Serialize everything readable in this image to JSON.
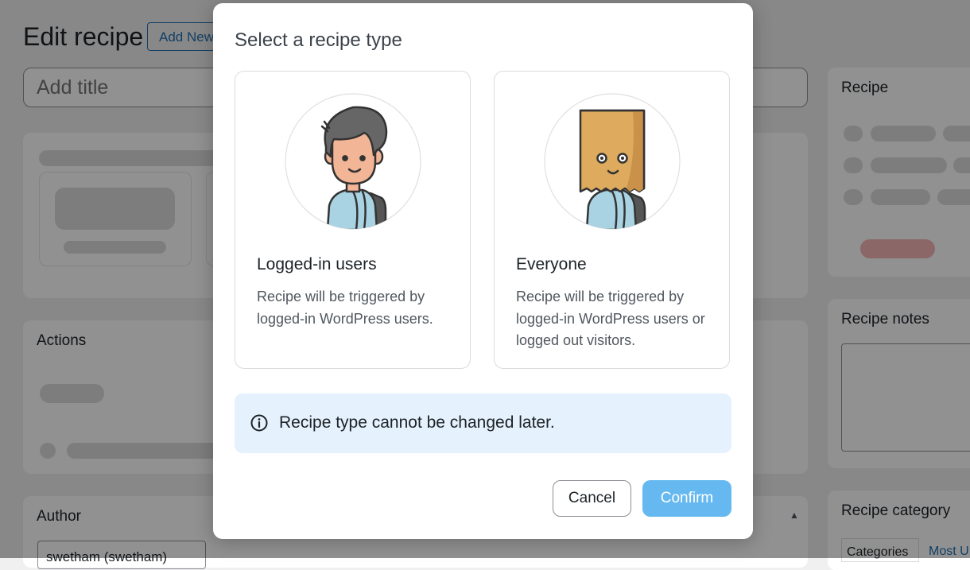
{
  "page": {
    "title": "Edit recipe",
    "add_new_label": "Add New",
    "title_placeholder": "Add title",
    "actions_title": "Actions",
    "author_title": "Author",
    "author_value": "swetham (swetham)"
  },
  "sidebar": {
    "recipe_title": "Recipe",
    "notes_title": "Recipe notes",
    "category_title": "Recipe category",
    "category_tabs": [
      "Categories",
      "Most U"
    ]
  },
  "modal": {
    "title": "Select a recipe type",
    "options": [
      {
        "title": "Logged-in users",
        "description": "Recipe will be triggered by logged-in WordPress users.",
        "icon": "logged-in-user-avatar-icon"
      },
      {
        "title": "Everyone",
        "description": "Recipe will be triggered by logged-in WordPress users or logged out visitors.",
        "icon": "paper-bag-avatar-icon"
      }
    ],
    "notice": {
      "icon": "info-icon",
      "text": "Recipe type cannot be changed later."
    },
    "cancel_label": "Cancel",
    "confirm_label": "Confirm"
  },
  "colors": {
    "confirm_bg": "#66b9f0",
    "notice_bg": "#e5f1fc"
  }
}
